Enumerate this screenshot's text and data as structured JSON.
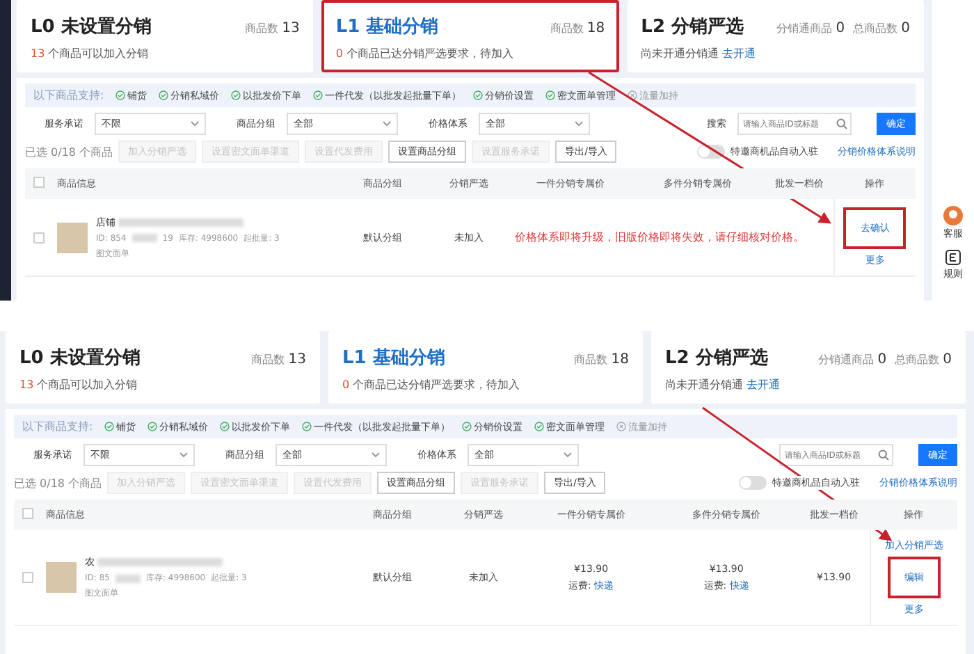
{
  "panels": [
    {
      "cards": [
        {
          "title": "L0 未设置分销",
          "selected": false,
          "highlighted": false,
          "stats": [
            {
              "label": "商品数",
              "value": "13"
            }
          ],
          "count": "13",
          "text": " 个商品可以加入分销"
        },
        {
          "title": "L1 基础分销",
          "selected": true,
          "highlighted": true,
          "stats": [
            {
              "label": "商品数",
              "value": "18"
            }
          ],
          "count": "0",
          "text": " 个商品已达分销严选要求，待加入"
        },
        {
          "title": "L2 分销严选",
          "selected": false,
          "highlighted": false,
          "stats": [
            {
              "label": "分销通商品",
              "value": "0"
            },
            {
              "label": "总商品数",
              "value": "0"
            }
          ],
          "text": "尚未开通分销通 ",
          "link": "去开通"
        }
      ],
      "supports": {
        "label": "以下商品支持:",
        "items": [
          {
            "text": "铺货",
            "enabled": true
          },
          {
            "text": "分销私域价",
            "enabled": true
          },
          {
            "text": "以批发价下单",
            "enabled": true
          },
          {
            "text": "一件代发（以批发起批量下单）",
            "enabled": true
          },
          {
            "text": "分销价设置",
            "enabled": true
          },
          {
            "text": "密文面单管理",
            "enabled": true
          },
          {
            "text": "流量加持",
            "enabled": false
          }
        ]
      },
      "filters": [
        {
          "label": "服务承诺",
          "value": "不限"
        },
        {
          "label": "商品分组",
          "value": "全部"
        },
        {
          "label": "价格体系",
          "value": "全部"
        }
      ],
      "search": {
        "label": "搜索",
        "placeholder": "请输入商品ID或标题"
      },
      "confirm": "确定",
      "toolbar": {
        "selected": "已选 0/18 个商品",
        "buttons": [
          {
            "label": "加入分销严选",
            "disabled": true
          },
          {
            "label": "设置密文面单渠道",
            "disabled": true
          },
          {
            "label": "设置代发费用",
            "disabled": true
          },
          {
            "label": "设置商品分组",
            "disabled": false
          },
          {
            "label": "设置服务承诺",
            "disabled": true
          },
          {
            "label": "导出/导入",
            "disabled": false
          }
        ],
        "toggle": {
          "label": "特邀商机品自动入驻",
          "on": false
        },
        "link": "分销价格体系说明"
      },
      "columns": [
        "商品信息",
        "商品分组",
        "分销严选",
        "一件分销专属价",
        "多件分销专属价",
        "批发一档价",
        "操作"
      ],
      "all_checked": false,
      "rows": [
        {
          "checked": false,
          "name": "店铺",
          "id": "ID: 854",
          "id_end": "19",
          "stock": "库存: 4998600",
          "min": "起批量: 3",
          "tag": "图文面单",
          "group": "默认分组",
          "status": "未加入",
          "warning": "价格体系即将升级，旧版价格即将失效，请仔细核对价格。",
          "actions": [
            {
              "label": "去确认",
              "highlighted": true
            },
            {
              "label": "更多",
              "highlighted": false
            }
          ]
        }
      ],
      "side_tools": [
        {
          "kind": "avatar",
          "label": "客服"
        },
        {
          "kind": "rule",
          "label": "规则"
        }
      ]
    },
    {
      "cards": [
        {
          "title": "L0 未设置分销",
          "selected": false,
          "highlighted": false,
          "stats": [
            {
              "label": "商品数",
              "value": "13"
            }
          ],
          "count": "13",
          "text": " 个商品可以加入分销"
        },
        {
          "title": "L1 基础分销",
          "selected": true,
          "highlighted": false,
          "stats": [
            {
              "label": "商品数",
              "value": "18"
            }
          ],
          "count": "0",
          "text": " 个商品已达分销严选要求，待加入"
        },
        {
          "title": "L2 分销严选",
          "selected": false,
          "highlighted": false,
          "stats": [
            {
              "label": "分销通商品",
              "value": "0"
            },
            {
              "label": "总商品数",
              "value": "0"
            }
          ],
          "text": "尚未开通分销通 ",
          "link": "去开通"
        }
      ],
      "supports": {
        "label": "以下商品支持:",
        "items": [
          {
            "text": "铺货",
            "enabled": true
          },
          {
            "text": "分销私域价",
            "enabled": true
          },
          {
            "text": "以批发价下单",
            "enabled": true
          },
          {
            "text": "一件代发（以批发起批量下单）",
            "enabled": true
          },
          {
            "text": "分销价设置",
            "enabled": true
          },
          {
            "text": "密文面单管理",
            "enabled": true
          },
          {
            "text": "流量加持",
            "enabled": false
          }
        ]
      },
      "filters": [
        {
          "label": "服务承诺",
          "value": "不限"
        },
        {
          "label": "商品分组",
          "value": "全部"
        },
        {
          "label": "价格体系",
          "value": "全部"
        }
      ],
      "search": {
        "placeholder": "请输入商品ID或标题"
      },
      "confirm": "确定",
      "toolbar": {
        "selected": "已选 0/18 个商品",
        "buttons": [
          {
            "label": "加入分销严选",
            "disabled": true
          },
          {
            "label": "设置密文面单渠道",
            "disabled": true
          },
          {
            "label": "设置代发费用",
            "disabled": true
          },
          {
            "label": "设置商品分组",
            "disabled": false
          },
          {
            "label": "设置服务承诺",
            "disabled": true
          },
          {
            "label": "导出/导入",
            "disabled": false
          }
        ],
        "toggle": {
          "label": "特邀商机品自动入驻",
          "on": false
        },
        "link": "分销价格体系说明"
      },
      "columns": [
        "商品信息",
        "商品分组",
        "分销严选",
        "一件分销专属价",
        "多件分销专属价",
        "批发一档价",
        "操作"
      ],
      "all_checked": false,
      "rows": [
        {
          "checked": false,
          "name": "农",
          "id": "ID: 85",
          "stock": "库存: 4998600",
          "min": "起批量: 3",
          "tag": "图文面单",
          "group": "默认分组",
          "status": "未加入",
          "prices": [
            {
              "price": "¥13.90",
              "freight": "运费: ",
              "link": "快递"
            },
            {
              "price": "¥13.90",
              "freight": "运费: ",
              "link": "快递"
            },
            {
              "price": "¥13.90"
            }
          ],
          "actions": [
            {
              "label": "加入分销严选",
              "highlighted": false
            },
            {
              "label": "编辑",
              "highlighted": true
            },
            {
              "label": "更多",
              "highlighted": false
            }
          ]
        }
      ]
    }
  ]
}
